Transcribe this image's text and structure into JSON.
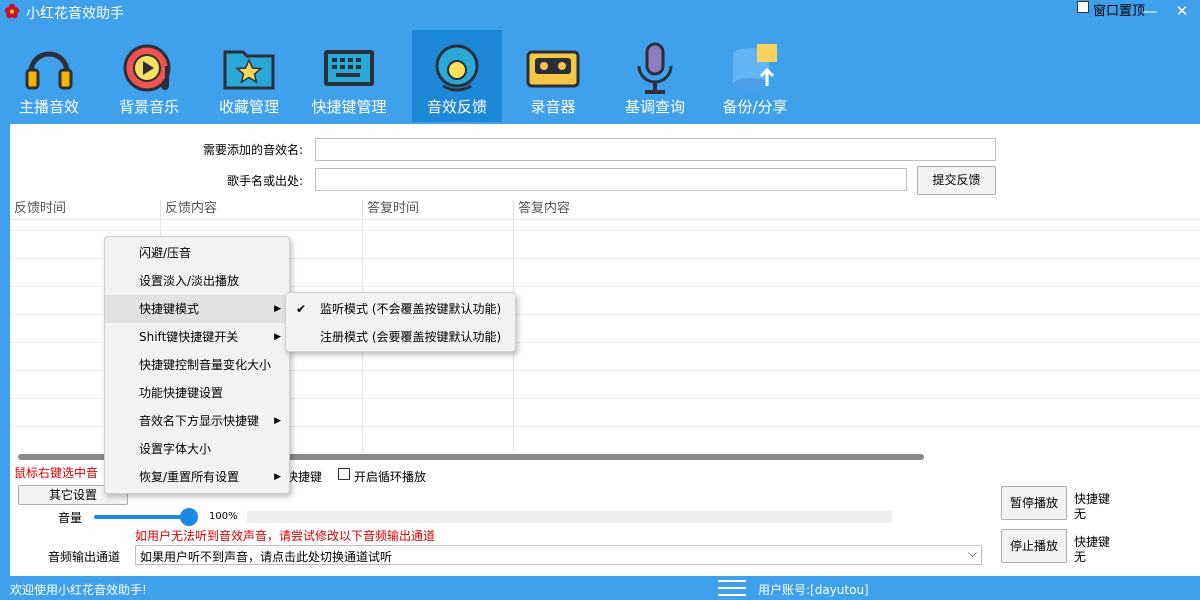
{
  "window": {
    "title": "小红花音效助手",
    "pin_label": "窗口置顶",
    "minimize": "—",
    "close": "✕"
  },
  "toolbar": {
    "items": [
      {
        "label": "主播音效",
        "icon": "headphones-icon"
      },
      {
        "label": "背景音乐",
        "icon": "music-disc-icon"
      },
      {
        "label": "收藏管理",
        "icon": "star-folder-icon"
      },
      {
        "label": "快捷键管理",
        "icon": "keyboard-icon"
      },
      {
        "label": "音效反馈",
        "icon": "feedback-icon"
      },
      {
        "label": "录音器",
        "icon": "cassette-icon"
      },
      {
        "label": "基调查询",
        "icon": "microphone-icon"
      },
      {
        "label": "备份/分享",
        "icon": "database-upload-icon"
      }
    ],
    "active_index": 4
  },
  "form": {
    "effect_name_label": "需要添加的音效名:",
    "effect_name_value": "",
    "singer_label": "歌手名或出处:",
    "singer_value": "",
    "submit_label": "提交反馈"
  },
  "grid": {
    "columns": [
      "反馈时间",
      "反馈内容",
      "答复时间",
      "答复内容"
    ],
    "rows": []
  },
  "controls": {
    "right_click_hint": "鼠标右键选中音",
    "shortcut_label": "快捷键",
    "loop_label": "开启循环播放",
    "loop_checked": false,
    "other_settings_label": "其它设置",
    "volume_label": "音量",
    "volume_value": "100%",
    "volume_fraction": 1.0,
    "audio_warning": "如用户无法听到音效声音，请尝试修改以下音频输出通道",
    "output_label": "音频输出通道",
    "output_selected": "如果用户听不到声音，请点击此处切换通道试听",
    "pause_label": "暂停播放",
    "pause_shortcut_title": "快捷键",
    "pause_shortcut_value": "无",
    "stop_label": "停止播放",
    "stop_shortcut_title": "快捷键",
    "stop_shortcut_value": "无"
  },
  "context_menu": {
    "items": [
      {
        "label": "闪避/压音",
        "submenu": false
      },
      {
        "label": "设置淡入/淡出播放",
        "submenu": false
      },
      {
        "label": "快捷键模式",
        "submenu": true
      },
      {
        "label": "Shift键快捷键开关",
        "submenu": true
      },
      {
        "label": "快捷键控制音量变化大小",
        "submenu": false
      },
      {
        "label": "功能快捷键设置",
        "submenu": false
      },
      {
        "label": "音效名下方显示快捷键",
        "submenu": true
      },
      {
        "label": "设置字体大小",
        "submenu": false
      },
      {
        "label": "恢复/重置所有设置",
        "submenu": true
      }
    ],
    "highlighted_index": 2
  },
  "submenu": {
    "items": [
      {
        "label": "监听模式 (不会覆盖按键默认功能)",
        "checked": true
      },
      {
        "label": "注册模式 (会要覆盖按键默认功能)",
        "checked": false
      }
    ]
  },
  "status": {
    "welcome": "欢迎使用小红花音效助手!",
    "account": "用户账号:[dayutou]"
  },
  "colors": {
    "chrome_blue": "#3fa0ec",
    "active_tab": "#1e88d8",
    "accent": "#1e88e5",
    "warning_red": "#e00000"
  }
}
